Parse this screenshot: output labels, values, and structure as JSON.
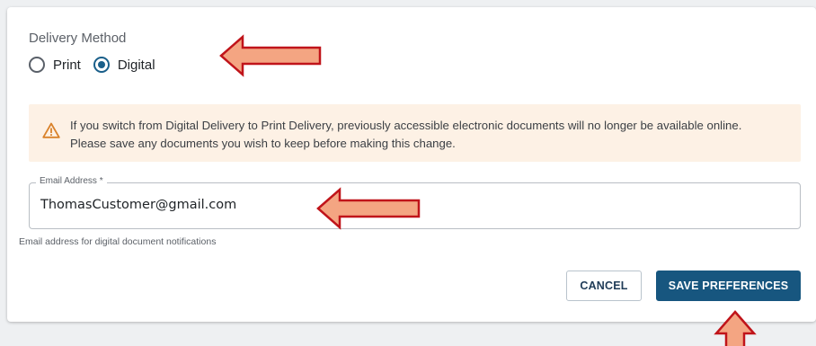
{
  "delivery": {
    "label": "Delivery Method",
    "options": [
      {
        "label": "Print",
        "selected": false
      },
      {
        "label": "Digital",
        "selected": true
      }
    ]
  },
  "warning": {
    "icon": "warning-triangle-icon",
    "line1": "If you switch from Digital Delivery to Print Delivery, previously accessible electronic documents will no longer be available online.",
    "line2": "Please save any documents you wish to keep before making this change."
  },
  "email": {
    "label": "Email Address *",
    "value": "ThomasCustomer@gmail.com",
    "helper": "Email address for digital document notifications"
  },
  "actions": {
    "cancel_label": "CANCEL",
    "save_label": "SAVE PREFERENCES"
  },
  "colors": {
    "accent": "#17567f",
    "warning_bg": "#fdf1e5",
    "warning_icon": "#d9822b",
    "annotation_fill": "#f4a582",
    "annotation_stroke": "#c0141a"
  }
}
